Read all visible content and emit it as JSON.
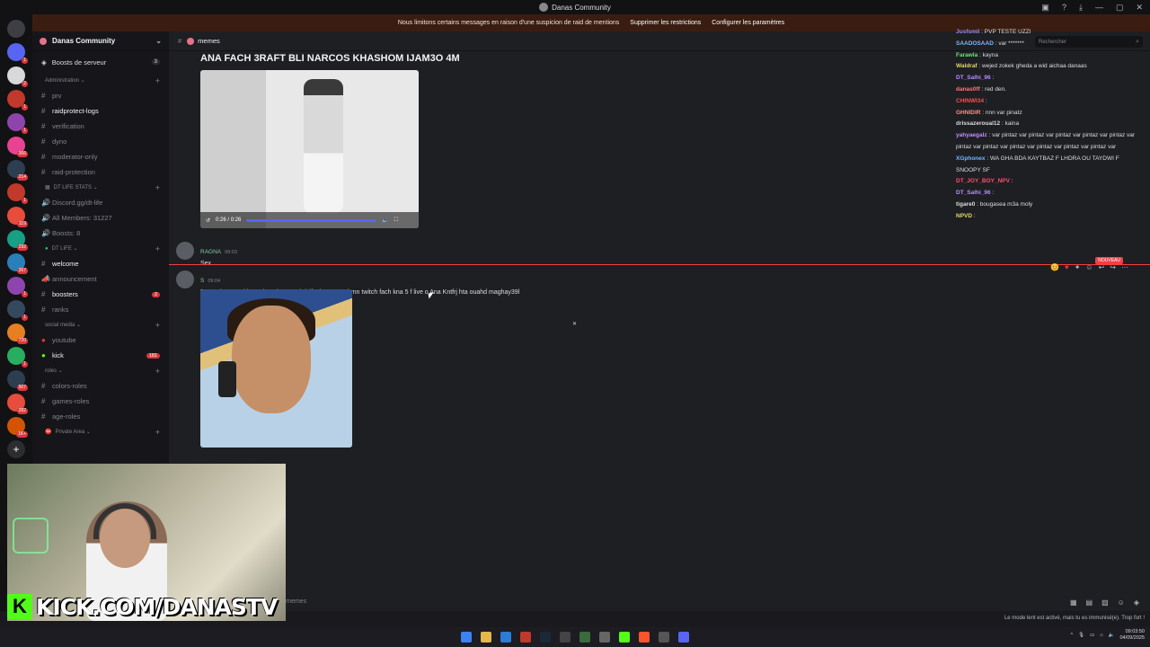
{
  "window": {
    "title": "Danas Community",
    "controls": [
      "—",
      "▢",
      "✕"
    ]
  },
  "banner": {
    "text": "Nous limitons certains messages en raison d'une suspicion de raid de mentions",
    "action1": "Supprimer les restrictions",
    "action2": "Configurer les paramètres"
  },
  "guild_badges": [
    "1",
    "2",
    "1",
    "1",
    "366",
    "214",
    "1",
    "119",
    "292",
    "267",
    "1",
    "1",
    "720",
    "1",
    "507",
    "282",
    "1K+"
  ],
  "server": {
    "name": "Danas Community",
    "boosts_label": "Boosts de serveur",
    "boosts_count": "3"
  },
  "categories": {
    "admin": "Administration",
    "dt_stats": "DT LIFE STATS",
    "dt_life": "DT LIFE",
    "social": "social media",
    "roles": "roles",
    "private": "Private Area"
  },
  "channels": {
    "admin": [
      "prv",
      "raidprotect-logs",
      "verification",
      "dyno",
      "moderator-only",
      "raid-protection"
    ],
    "stats": [
      "Discord.gg/dt-life",
      "All Members: 31227",
      "Boosts: 8"
    ],
    "dtlife": [
      "welcome",
      "announcement",
      "boosters",
      "ranks"
    ],
    "boosters_badge": "2",
    "social": [
      "youtube",
      "kick"
    ],
    "kick_badge": "181",
    "roles": [
      "colors-roles",
      "games-roles",
      "age-roles"
    ]
  },
  "channel_header": {
    "name": "memes",
    "search_placeholder": "Rechercher"
  },
  "post": {
    "title": "ANA FACH 3RAFT BLI NARCOS KHASHOM IJAM3O 4M",
    "video_time": "0:26 / 0:26"
  },
  "messages": [
    {
      "author": "RAGNA",
      "time": "09:03",
      "text": "Sex"
    },
    {
      "author": "S",
      "time": "09:04",
      "text": "Danas kay3ayt l bounda o dom Bach islfouh 1m : rani mn twitch fach kna 5 f live o Ana Kntfrj hta ouahd maghay39l"
    }
  ],
  "new_label": "NOUVEAU",
  "chatbox": {
    "placeholder": "memes"
  },
  "slowmode": "Le mode lent est activé, mais tu es immunisé(e). Trop fort !",
  "overlay_chat": [
    {
      "user": "Jusfsmil",
      "text": "PVP TESTE UZZI",
      "color": "#9b8cff"
    },
    {
      "user": "SAADOSAAD",
      "text": "var *******",
      "color": "#7ab8ff"
    },
    {
      "user": "Farawla",
      "text": "kayna",
      "color": "#6fe37a"
    },
    {
      "user": "Waldraf",
      "text": "wejed zokek gheda a wid aichaa danaas",
      "color": "#e3d86f"
    },
    {
      "user": "DT_Salhi_96",
      "text": "",
      "color": "#b68cff"
    },
    {
      "user": "danas0ff",
      "text": "red den.",
      "color": "#ff7a7a"
    },
    {
      "user": "CHINWI34",
      "text": "",
      "color": "#ff4d4d"
    },
    {
      "user": "GHNIDIR",
      "text": "nnn var pinatz",
      "color": "#ff8c8c"
    },
    {
      "user": "drissazeroual12",
      "text": "kaina",
      "color": "#dddddd"
    },
    {
      "user": "yahyaegalz",
      "text": "var pintaz var pintaz var pintaz var pintaz var pintaz var pintaz var pintaz var pintaz var pintaz var pintaz var pintaz var",
      "color": "#c48cff"
    },
    {
      "user": "XGphonex",
      "text": "WA GHA BDA KAYTBAZ F LHDRA OU TAYDWI F SNOOPY SF",
      "color": "#6fb8ff"
    },
    {
      "user": "DT_JOY_BOY_NPV",
      "text": "",
      "color": "#ff4d6d"
    },
    {
      "user": "DT_Salhi_96",
      "text": "",
      "color": "#b68cff"
    },
    {
      "user": "tigare0",
      "text": "bougasea m3a moly",
      "color": "#dddddd"
    },
    {
      "user": "NPVD",
      "text": "",
      "color": "#e3d86f"
    }
  ],
  "stream": {
    "brand": "KICK.COM/DANASTV",
    "k": "K"
  },
  "clock": {
    "time": "09:03:50",
    "date": "04/09/2025"
  },
  "colors": {
    "accent": "#5865f2",
    "danger": "#f23f43",
    "kick": "#53fc18"
  }
}
